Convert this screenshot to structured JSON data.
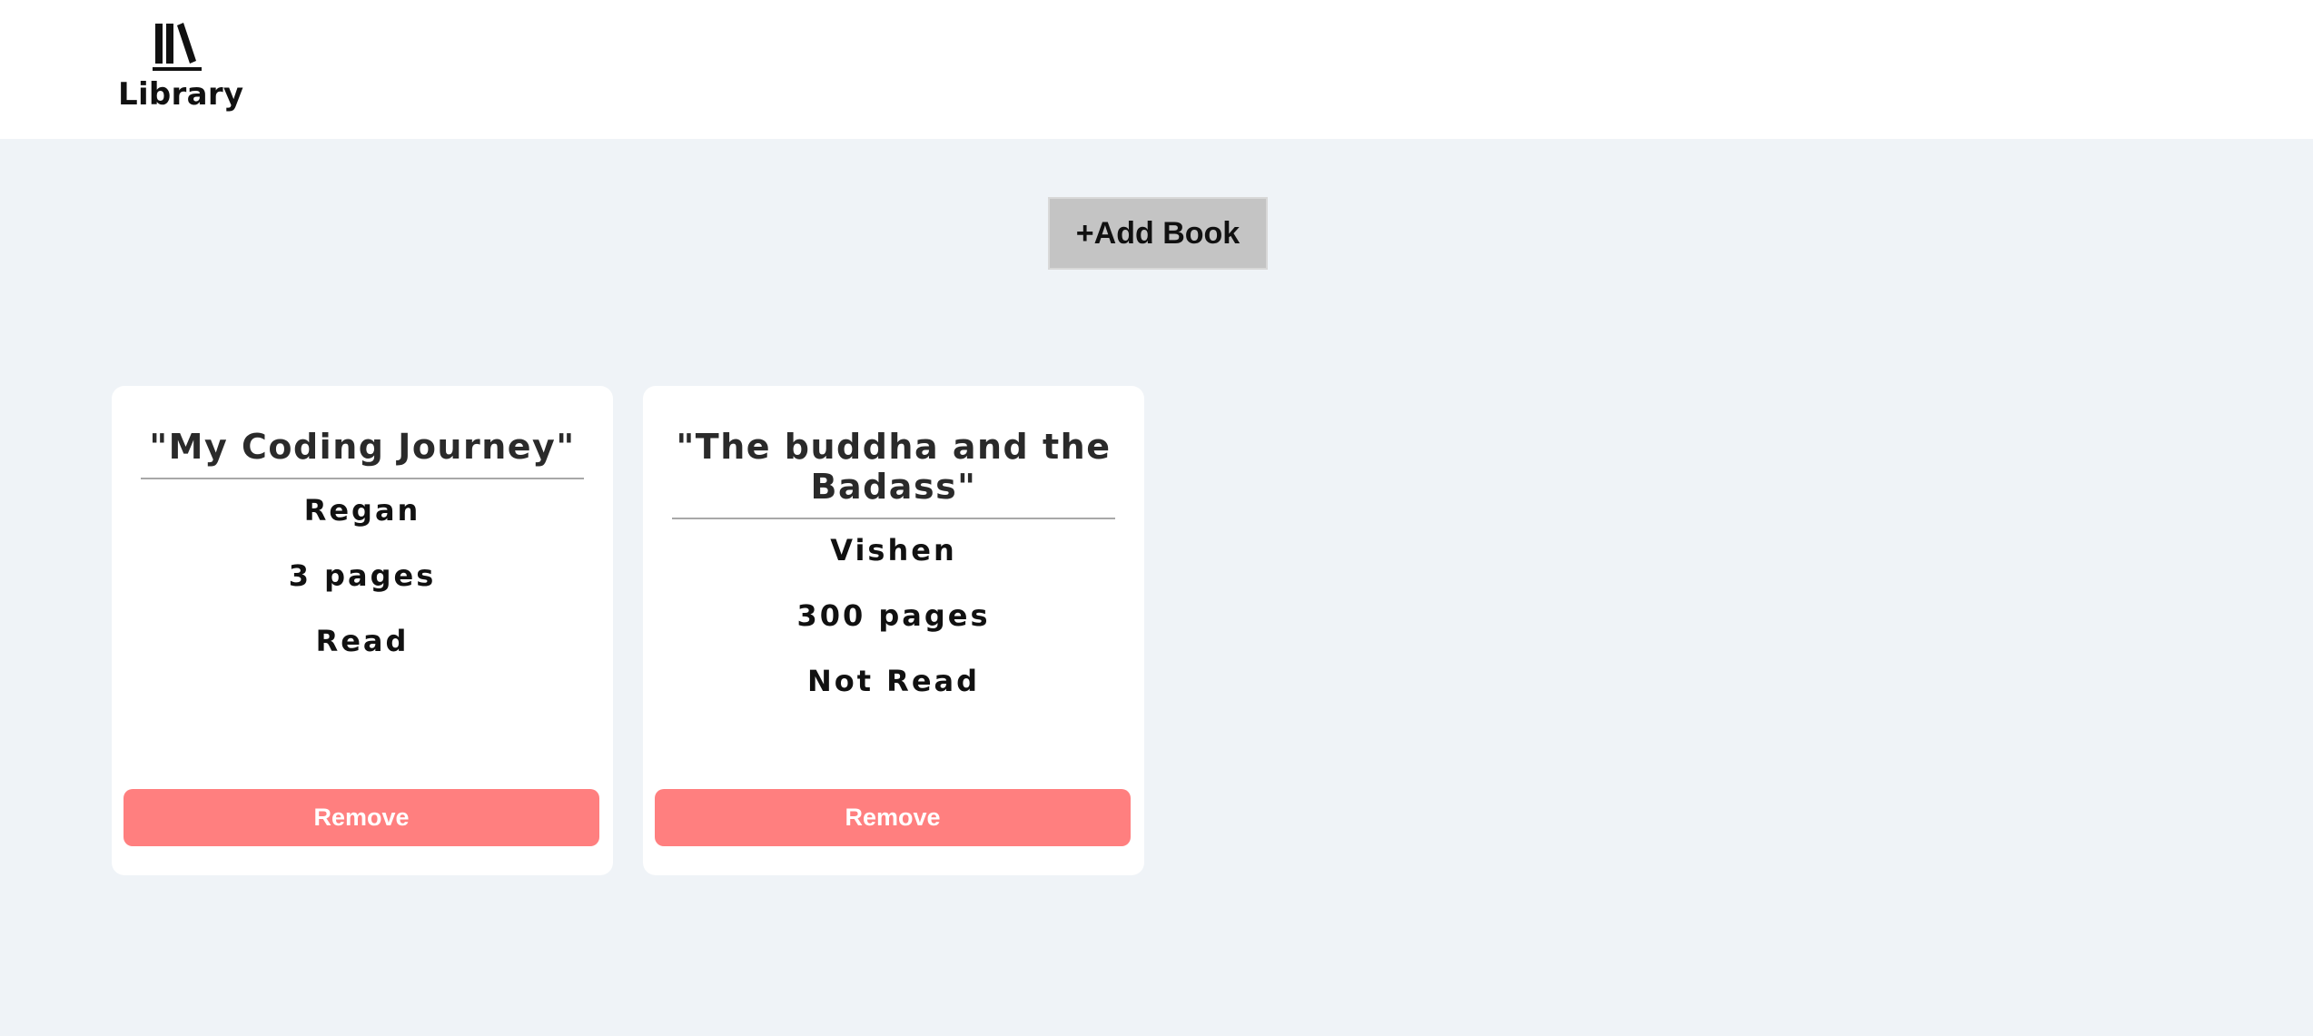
{
  "header": {
    "logo_icon": "books-icon",
    "title": "Library"
  },
  "toolbar": {
    "add_label": "+Add Book"
  },
  "colors": {
    "header_bg": "#ffffff",
    "page_bg": "#eff3f7",
    "add_button_bg": "#c4c4c4",
    "remove_button_bg": "#ff7f7f",
    "card_bg": "#ffffff"
  },
  "books": [
    {
      "title": "\"My Coding Journey\"",
      "author": "Regan",
      "pages": "3 pages",
      "status": "Read",
      "remove_label": "Remove"
    },
    {
      "title": "\"The buddha and the Badass\"",
      "author": "Vishen",
      "pages": "300 pages",
      "status": "Not Read",
      "remove_label": "Remove"
    }
  ]
}
